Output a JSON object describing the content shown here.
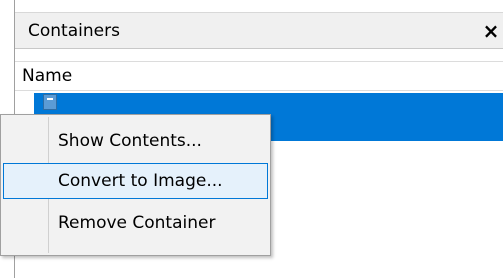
{
  "panel": {
    "title": "Containers",
    "close_label": "×"
  },
  "list": {
    "column_header": "Name",
    "selected_row": {
      "icon": "container-icon"
    }
  },
  "context_menu": {
    "items": [
      {
        "label": "Show Contents...",
        "highlighted": false
      },
      {
        "label": "Convert to Image...",
        "highlighted": true
      },
      {
        "label": "Remove Container",
        "highlighted": false
      }
    ]
  },
  "colors": {
    "selection": "#0078d7",
    "menu_background": "#f2f2f2",
    "menu_highlight": "#e5f1fb",
    "menu_highlight_border": "#0078d7"
  }
}
